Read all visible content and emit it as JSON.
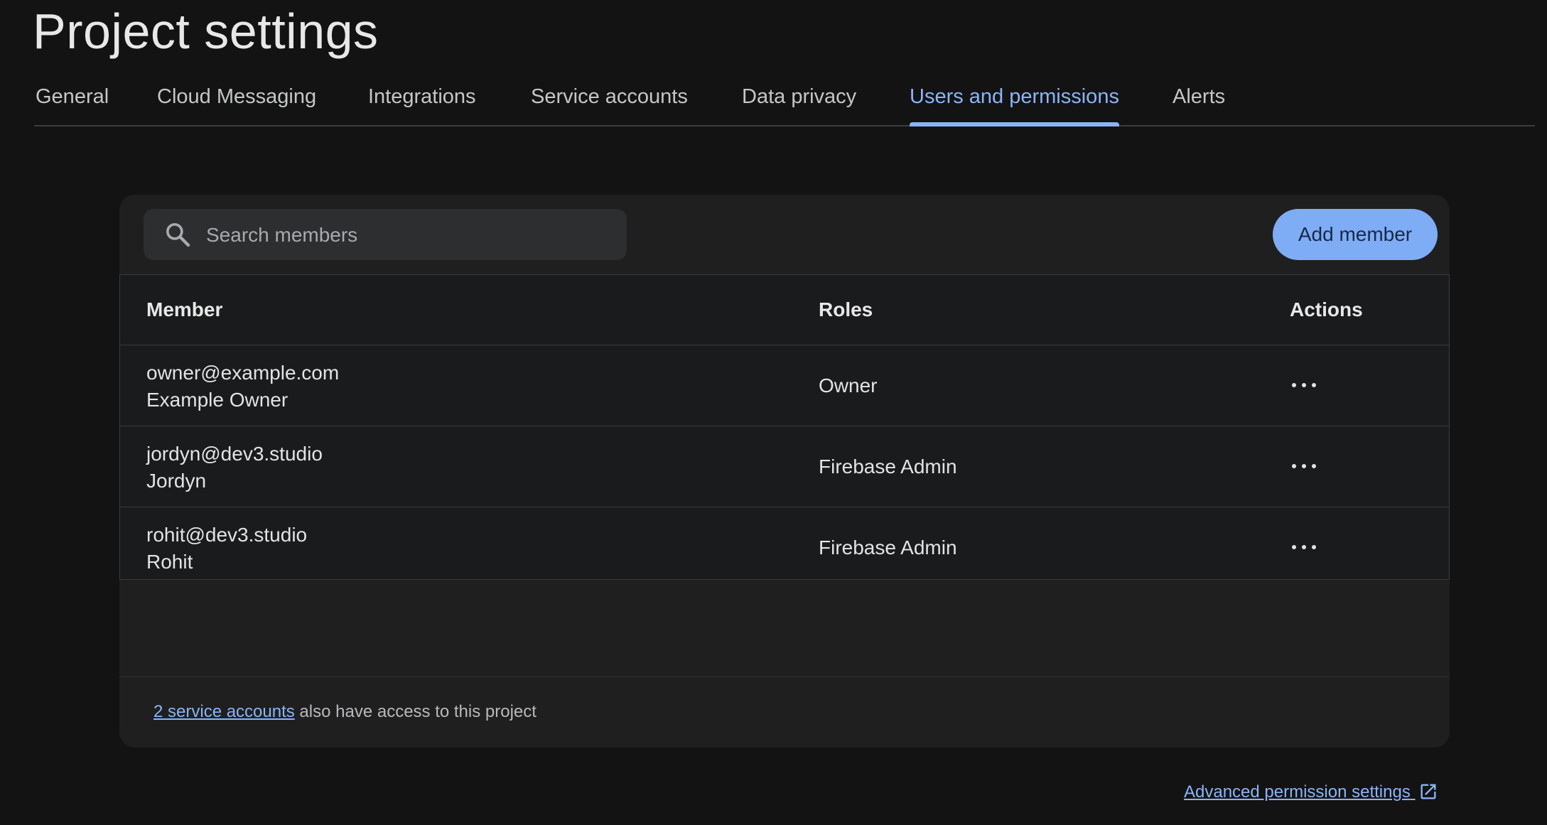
{
  "page": {
    "title": "Project settings"
  },
  "tabs": [
    {
      "label": "General",
      "active": false
    },
    {
      "label": "Cloud Messaging",
      "active": false
    },
    {
      "label": "Integrations",
      "active": false
    },
    {
      "label": "Service accounts",
      "active": false
    },
    {
      "label": "Data privacy",
      "active": false
    },
    {
      "label": "Users and permissions",
      "active": true
    },
    {
      "label": "Alerts",
      "active": false
    }
  ],
  "search": {
    "placeholder": "Search members",
    "value": "",
    "icon": "search-icon"
  },
  "add_member_label": "Add member",
  "table": {
    "headers": {
      "member": "Member",
      "roles": "Roles",
      "actions": "Actions"
    },
    "rows": [
      {
        "email": "owner@example.com",
        "name": "Example Owner",
        "role": "Owner",
        "actions_icon": "more-horizontal-icon"
      },
      {
        "email": "jordyn@dev3.studio",
        "name": "Jordyn",
        "role": "Firebase Admin",
        "actions_icon": "more-horizontal-icon"
      },
      {
        "email": "rohit@dev3.studio",
        "name": "Rohit",
        "role": "Firebase Admin",
        "actions_icon": "more-horizontal-icon"
      }
    ]
  },
  "footer": {
    "service_accounts_link": "2 service accounts",
    "service_accounts_text": " also have access to this project"
  },
  "advanced_link": {
    "label": "Advanced permission settings",
    "icon": "external-link-icon"
  },
  "colors": {
    "background": "#131313",
    "accent": "#8ab4f8",
    "card": "#1f1f1f",
    "button": "#7fadf5"
  }
}
